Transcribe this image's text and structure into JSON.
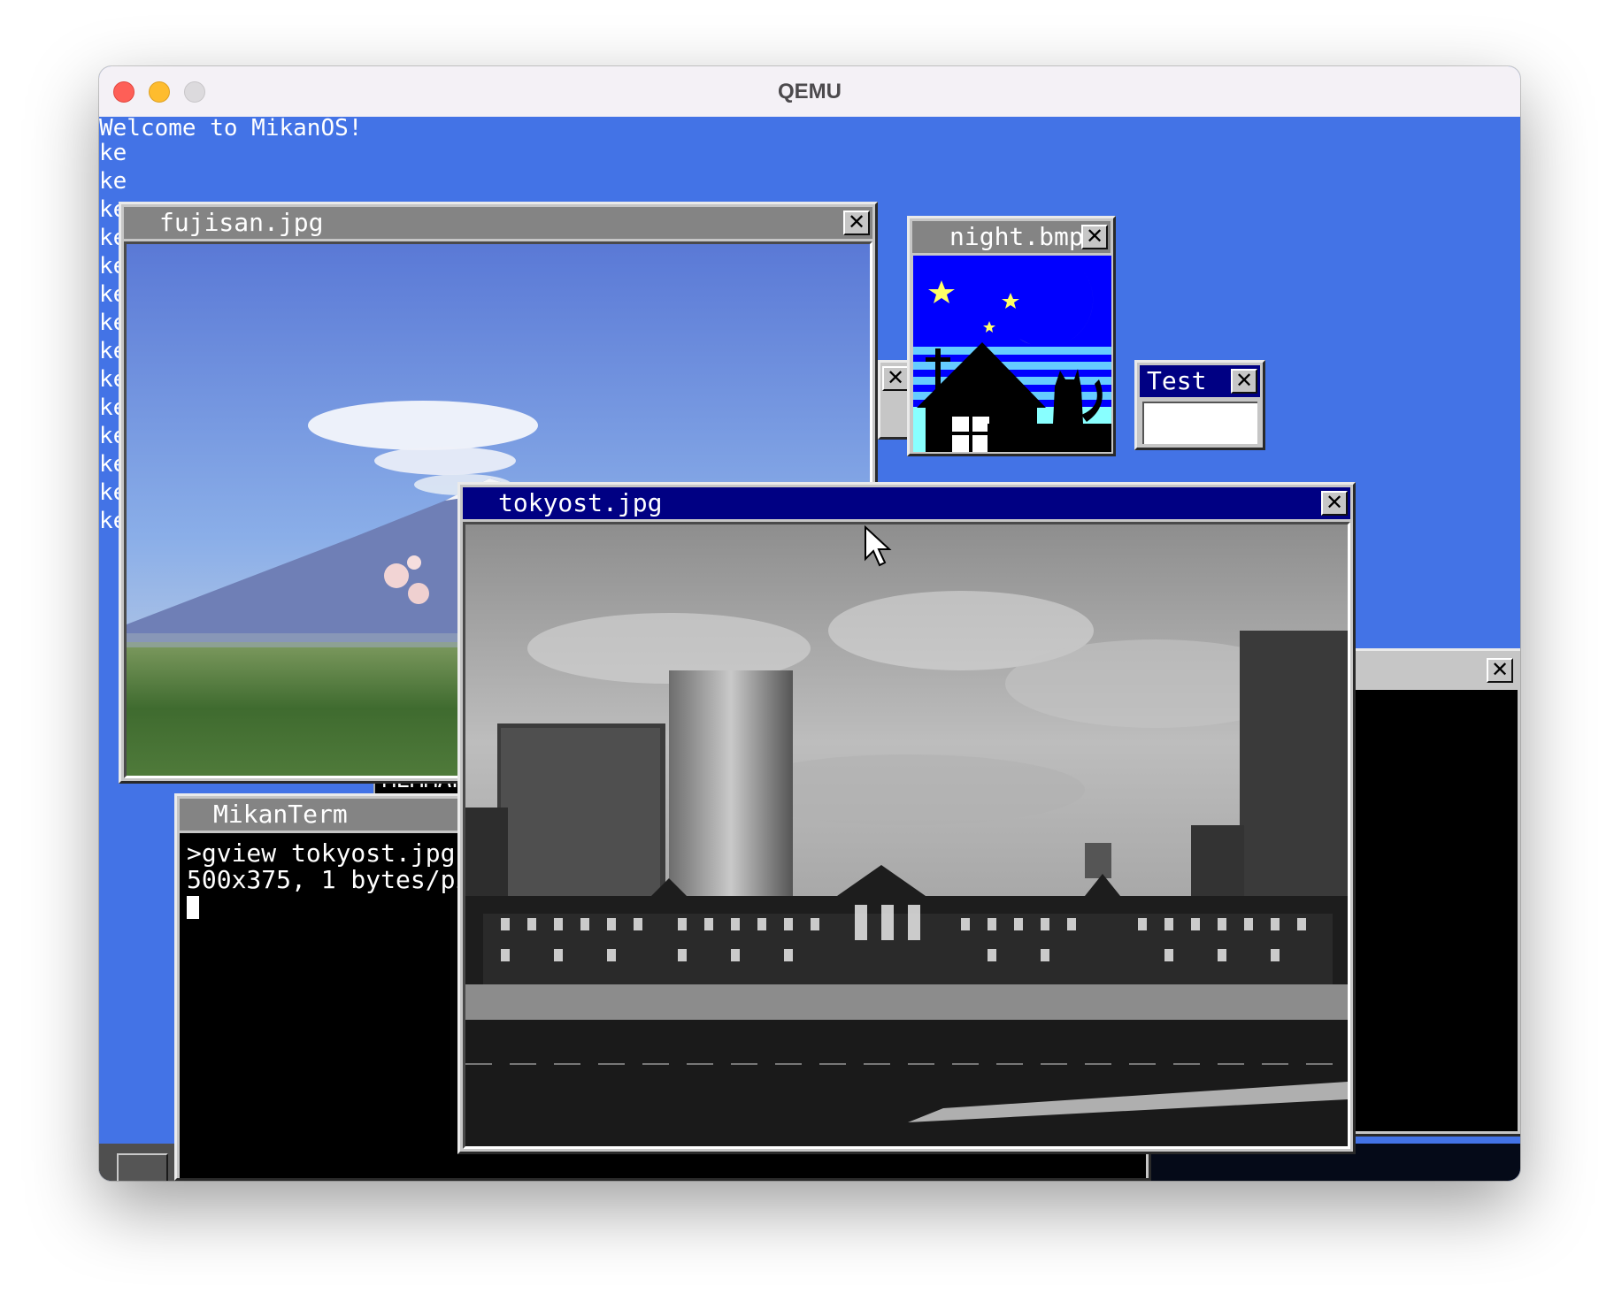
{
  "host_window": {
    "title": "QEMU"
  },
  "console": {
    "welcome": "Welcome to MikanOS!",
    "line_prefix": "ke"
  },
  "windows": {
    "fujisan": {
      "title": "fujisan.jpg",
      "close": "✕"
    },
    "night": {
      "title": "night.bmp",
      "close": "✕"
    },
    "test": {
      "title": "Test",
      "close": "✕"
    },
    "hidden_back": {
      "close": "✕"
    },
    "hidden_right": {
      "close": "✕"
    },
    "memmap": {
      "title": "MEMMAP"
    },
    "terminal": {
      "title": "MikanTerm",
      "lines": [
        ">gview tokyost.jpg",
        "500x375, 1 bytes/pi"
      ]
    },
    "tokyost": {
      "title": "tokyost.jpg",
      "close": "✕"
    }
  },
  "icons": {
    "close": "close-icon",
    "pointer": "mouse-pointer-icon",
    "taskbar_button": "taskbar-button"
  },
  "colors": {
    "desktop": "#4373e6",
    "active_title": "#000083",
    "inactive_title": "#848484",
    "window_face": "#c6c6c6"
  }
}
